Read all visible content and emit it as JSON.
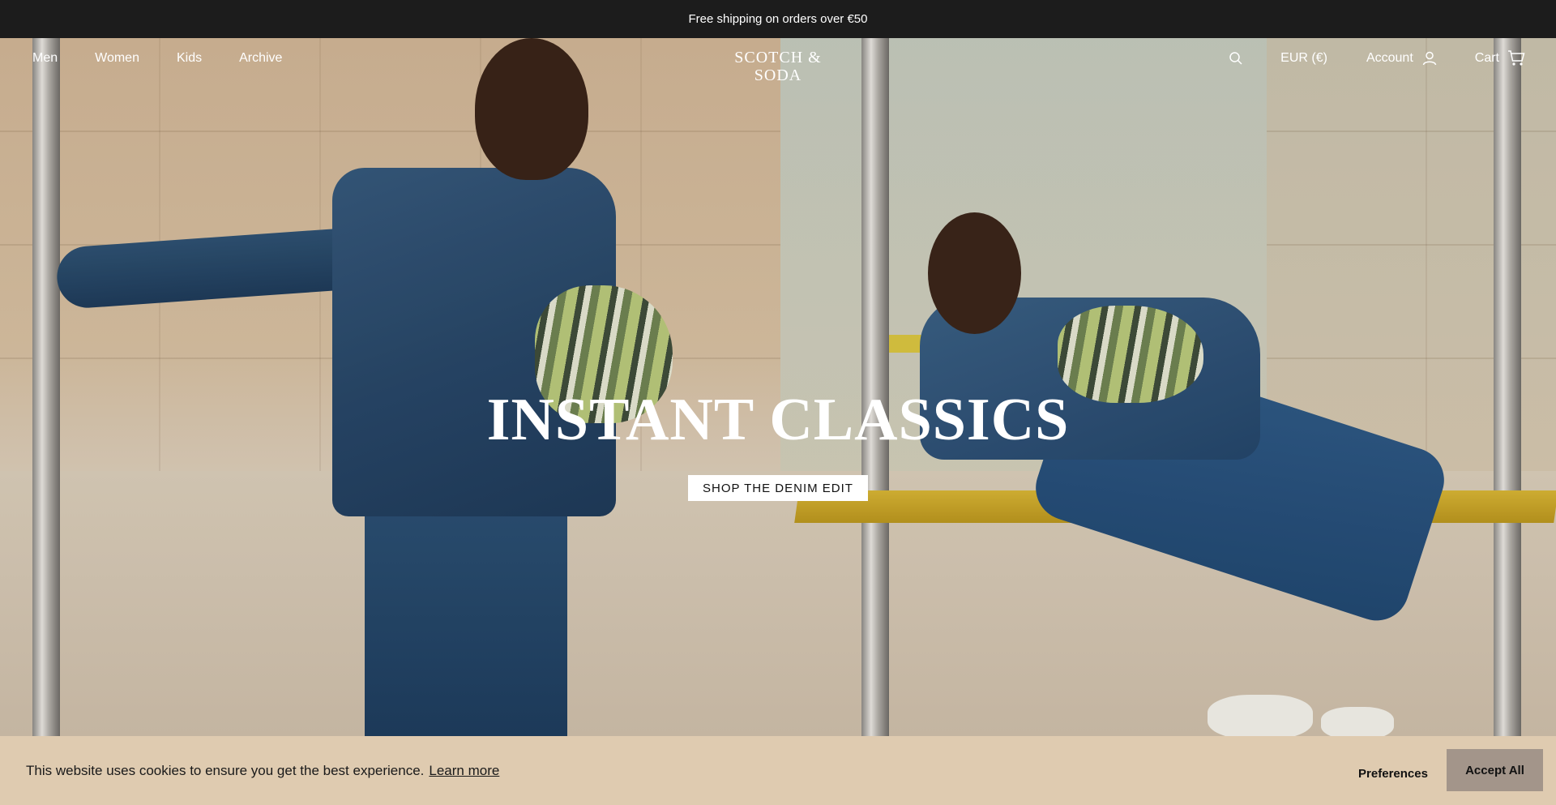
{
  "announcement": {
    "text": "Free shipping on orders over €50"
  },
  "nav": {
    "links": [
      "Men",
      "Women",
      "Kids",
      "Archive"
    ],
    "logo": "SCOTCH & SODA",
    "search_icon": "search-icon",
    "currency": "EUR (€)",
    "account": "Account",
    "account_icon": "user-icon",
    "cart": "Cart",
    "cart_icon": "cart-icon"
  },
  "hero": {
    "title": "INSTANT CLASSICS",
    "cta": "SHOP THE DENIM EDIT"
  },
  "cookie": {
    "message": "This website uses cookies to ensure you get the best experience.",
    "learn_more": "Learn more",
    "preferences": "Preferences",
    "accept": "Accept All"
  },
  "colors": {
    "announcement_bg": "#1c1c1c",
    "cookie_bg": "#dfcbb0",
    "accept_bg": "#a3958a"
  }
}
